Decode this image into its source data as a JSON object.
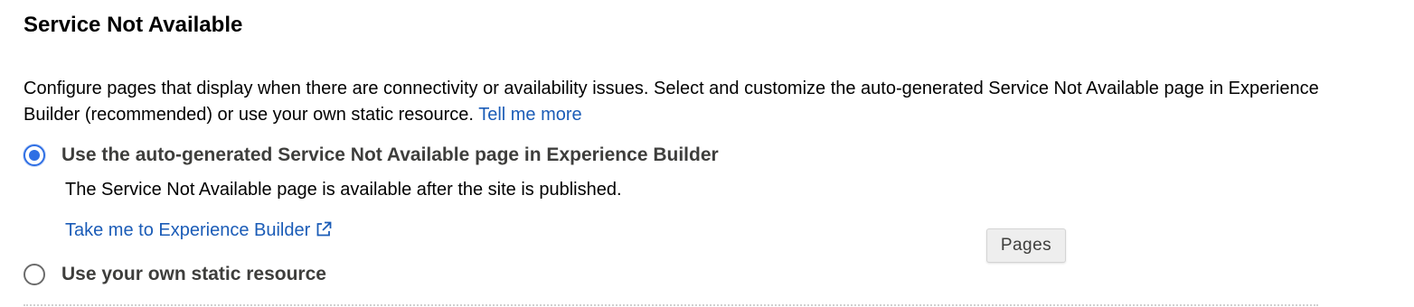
{
  "section": {
    "title": "Service Not Available",
    "description": "Configure pages that display when there are connectivity or availability issues. Select and customize the auto-generated Service Not Available page in Experience Builder (recommended) or use your own static resource.",
    "tell_me_more_link": "Tell me more"
  },
  "options": {
    "auto_generated": {
      "label": "Use the auto-generated Service Not Available page in Experience Builder",
      "selected": true,
      "detail": "The Service Not Available page is available after the site is published.",
      "link_label": "Take me to Experience Builder",
      "link_icon": "external-link-icon"
    },
    "static_resource": {
      "label": "Use your own static resource",
      "selected": false
    }
  },
  "tooltip": {
    "text": "Pages"
  },
  "colors": {
    "link": "#1b5cb7",
    "radio_selected": "#2f6fe4",
    "radio_label": "#3e3e3c"
  }
}
